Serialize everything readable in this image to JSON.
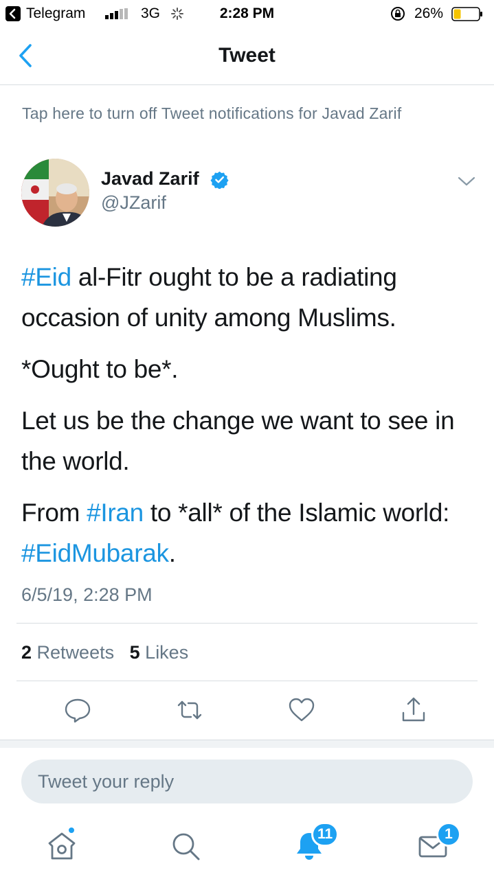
{
  "status_bar": {
    "back_app": "Telegram",
    "network": "3G",
    "time": "2:28 PM",
    "battery": "26%"
  },
  "nav": {
    "title": "Tweet"
  },
  "notification_link": "Tap here to turn off Tweet notifications for Javad Zarif",
  "tweet": {
    "author_name": "Javad Zarif",
    "handle": "@JZarif",
    "paragraphs": [
      {
        "tag1": "#Eid",
        "text1": " al-Fitr ought to be a radiating occasion of unity among Muslims."
      },
      {
        "text": "*Ought to be*."
      },
      {
        "text": "Let us be the change we want to see in the world."
      },
      {
        "pre": "From ",
        "tag": "#Iran",
        "mid": " to *all* of the Islamic world: ",
        "tag2": "#EidMubarak",
        "post": "."
      }
    ],
    "timestamp": "6/5/19, 2:28 PM",
    "retweets_count": "2",
    "retweets_label": "Retweets",
    "likes_count": "5",
    "likes_label": "Likes"
  },
  "reply": {
    "placeholder": "Tweet your reply"
  },
  "tabbar": {
    "notifications_badge": "11",
    "messages_badge": "1"
  },
  "colors": {
    "accent": "#1da1f2",
    "hashtag": "#1b95e0",
    "secondary_text": "#657786"
  }
}
